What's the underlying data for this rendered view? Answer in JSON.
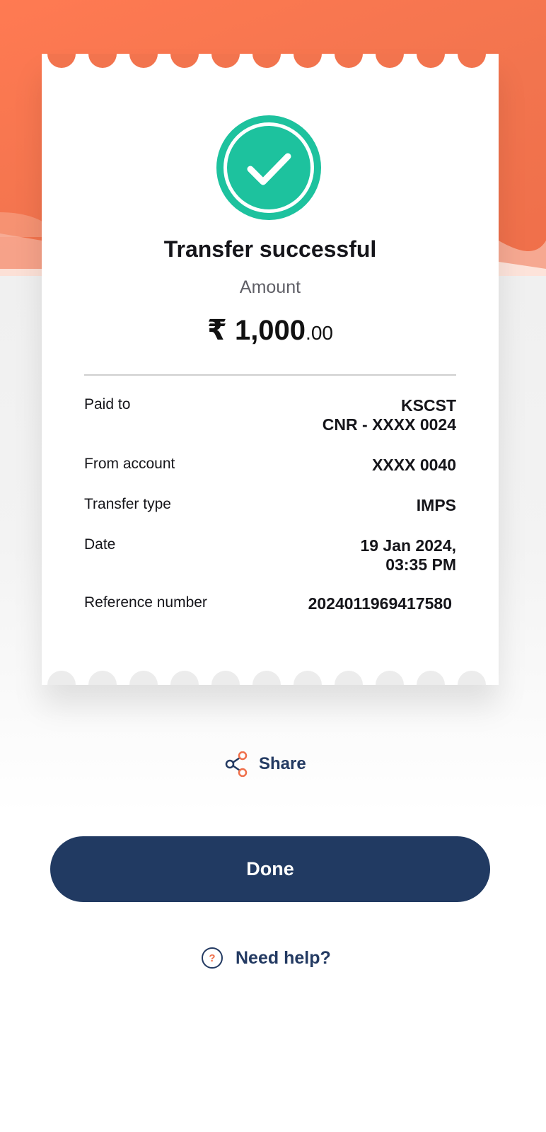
{
  "receipt": {
    "title": "Transfer successful",
    "amount_label": "Amount",
    "amount_main": "₹ 1,000",
    "amount_decimal": ".00",
    "details": [
      {
        "label": "Paid to",
        "value": "KSCST\nCNR - XXXX 0024"
      },
      {
        "label": "From account",
        "value": "XXXX 0040"
      },
      {
        "label": "Transfer type",
        "value": "IMPS"
      },
      {
        "label": "Date",
        "value": "19 Jan 2024,\n03:35 PM"
      },
      {
        "label": "Reference number",
        "value": "2024011969417580"
      }
    ]
  },
  "actions": {
    "share_label": "Share",
    "done_label": "Done",
    "help_label": "Need help?"
  },
  "icons": {
    "success": "check-circle-icon",
    "share": "share-icon",
    "help": "question-circle-icon"
  },
  "colors": {
    "header_bg": "#F2744E",
    "success_green": "#1DC29E",
    "primary_navy": "#213A62",
    "share_accent": "#EF6F4A"
  }
}
